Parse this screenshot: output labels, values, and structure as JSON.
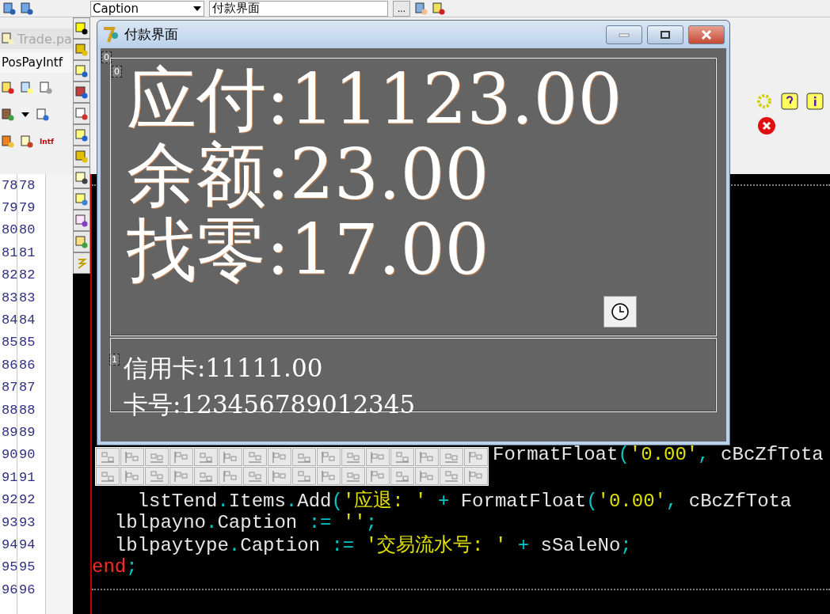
{
  "toolbar": {
    "property": "Caption",
    "value": "付款界面",
    "more": "..."
  },
  "left_panel": {
    "file_tab": "Trade.pa",
    "unit_tab": "PosPayIntf",
    "icon_label": "Intf"
  },
  "line_numbers_a": [
    "78",
    "79",
    "80",
    "81",
    "82",
    "83",
    "84",
    "85",
    "86",
    "87",
    "88",
    "89",
    "90",
    "91",
    "92",
    "93",
    "94",
    "95",
    "96"
  ],
  "line_numbers_b": [
    "78",
    "79",
    "80",
    "81",
    "82",
    "83",
    "84",
    "85",
    "86",
    "87",
    "88",
    "89",
    "90",
    "91",
    "92",
    "93",
    "94",
    "95",
    "96"
  ],
  "code_lines": [
    {
      "kind": "separator"
    },
    {
      "kind": "blank"
    },
    {
      "kind": "blank"
    },
    {
      "kind": "blank"
    },
    {
      "kind": "blank"
    },
    {
      "kind": "blank"
    },
    {
      "kind": "blank"
    },
    {
      "kind": "blank"
    },
    {
      "kind": "blank"
    },
    {
      "kind": "blank"
    },
    {
      "kind": "blank"
    },
    {
      "kind": "blank"
    },
    {
      "kind": "tail",
      "tokens": [
        {
          "kind": "id",
          "text": "FormatFloat"
        },
        {
          "kind": "op",
          "text": "("
        },
        {
          "kind": "str",
          "text": "'0.00'"
        },
        {
          "kind": "op",
          "text": ", "
        },
        {
          "kind": "id",
          "text": "cBcZfTota"
        }
      ]
    },
    {
      "kind": "blank"
    },
    {
      "kind": "code",
      "tokens": [
        {
          "kind": "id",
          "text": "    lstTend"
        },
        {
          "kind": "op",
          "text": "."
        },
        {
          "kind": "id",
          "text": "Items"
        },
        {
          "kind": "op",
          "text": "."
        },
        {
          "kind": "id",
          "text": "Add"
        },
        {
          "kind": "op",
          "text": "("
        },
        {
          "kind": "str",
          "text": "'应退: '"
        },
        {
          "kind": "op",
          "text": " + "
        },
        {
          "kind": "id",
          "text": "FormatFloat"
        },
        {
          "kind": "op",
          "text": "("
        },
        {
          "kind": "str",
          "text": "'0.00'"
        },
        {
          "kind": "op",
          "text": ", "
        },
        {
          "kind": "id",
          "text": "cBcZfTota"
        }
      ]
    },
    {
      "kind": "code",
      "tokens": [
        {
          "kind": "id",
          "text": "  lblpayno"
        },
        {
          "kind": "op",
          "text": "."
        },
        {
          "kind": "id",
          "text": "Caption "
        },
        {
          "kind": "op",
          "text": ":= "
        },
        {
          "kind": "str",
          "text": "''"
        },
        {
          "kind": "op",
          "text": ";"
        }
      ]
    },
    {
      "kind": "code",
      "tokens": [
        {
          "kind": "id",
          "text": "  lblpaytype"
        },
        {
          "kind": "op",
          "text": "."
        },
        {
          "kind": "id",
          "text": "Caption "
        },
        {
          "kind": "op",
          "text": ":= "
        },
        {
          "kind": "str",
          "text": "'交易流水号: '"
        },
        {
          "kind": "op",
          "text": " + "
        },
        {
          "kind": "id",
          "text": "sSaleNo"
        },
        {
          "kind": "op",
          "text": ";"
        }
      ]
    },
    {
      "kind": "code",
      "tokens": [
        {
          "kind": "kw",
          "text": "end"
        },
        {
          "kind": "op",
          "text": ";"
        }
      ]
    },
    {
      "kind": "separator"
    }
  ],
  "form_window": {
    "title": "付款界面",
    "tags": [
      "0",
      "0",
      "1"
    ],
    "amount_lines": [
      "应付:11123.00",
      "余额:23.00",
      "找零:17.00"
    ],
    "card_lines": [
      "信用卡:11111.00",
      "卡号:123456789012345"
    ]
  }
}
